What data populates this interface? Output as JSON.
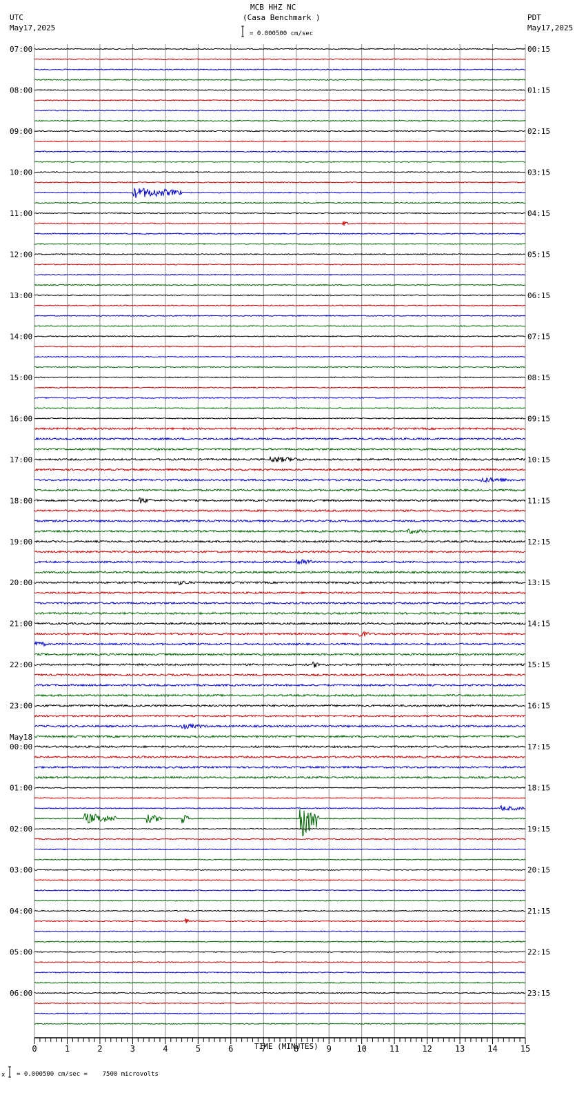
{
  "header": {
    "station": "MCB HHZ NC",
    "location": "(Casa Benchmark )",
    "left_tz": "UTC",
    "left_date": "May17,2025",
    "right_tz": "PDT",
    "right_date": "May17,2025",
    "scale": "= 0.000500 cm/sec"
  },
  "footer": {
    "scale": "= 0.000500 cm/sec =    7500 microvolts",
    "mark": "x"
  },
  "chart_data": {
    "type": "line",
    "title": "MCB HHZ NC (Casa Benchmark )",
    "xlabel": "TIME (MINUTES)",
    "xlim": [
      0,
      15
    ],
    "x_ticks": [
      "0",
      "1",
      "2",
      "3",
      "4",
      "5",
      "6",
      "7",
      "8",
      "9",
      "10",
      "11",
      "12",
      "13",
      "14",
      "15"
    ],
    "trace_colors": [
      "#000000",
      "#cc0000",
      "#0000cc",
      "#006600"
    ],
    "traces_per_hour": 4,
    "date_change_label": "May18",
    "left_labels": [
      "07:00",
      "08:00",
      "09:00",
      "10:00",
      "11:00",
      "12:00",
      "13:00",
      "14:00",
      "15:00",
      "16:00",
      "17:00",
      "18:00",
      "19:00",
      "20:00",
      "21:00",
      "22:00",
      "23:00",
      "00:00",
      "01:00",
      "02:00",
      "03:00",
      "04:00",
      "05:00",
      "06:00"
    ],
    "right_labels": [
      "00:15",
      "01:15",
      "02:15",
      "03:15",
      "04:15",
      "05:15",
      "06:15",
      "07:15",
      "08:15",
      "09:15",
      "10:15",
      "11:15",
      "12:15",
      "13:15",
      "14:15",
      "15:15",
      "16:15",
      "17:15",
      "18:15",
      "19:15",
      "20:15",
      "21:15",
      "22:15",
      "23:15"
    ],
    "events": [
      {
        "trace": 14,
        "minute": 3.0,
        "duration": 1.5,
        "amplitude": 8
      },
      {
        "trace": 17,
        "minute": 9.4,
        "duration": 0.2,
        "amplitude": 4
      },
      {
        "trace": 40,
        "minute": 7.2,
        "duration": 1.0,
        "amplitude": 5
      },
      {
        "trace": 42,
        "minute": 13.6,
        "duration": 1.2,
        "amplitude": 4
      },
      {
        "trace": 44,
        "minute": 3.2,
        "duration": 0.4,
        "amplitude": 5
      },
      {
        "trace": 47,
        "minute": 11.4,
        "duration": 0.6,
        "amplitude": 4
      },
      {
        "trace": 50,
        "minute": 8.0,
        "duration": 0.5,
        "amplitude": 6
      },
      {
        "trace": 52,
        "minute": 4.4,
        "duration": 0.4,
        "amplitude": 4
      },
      {
        "trace": 57,
        "minute": 9.9,
        "duration": 0.3,
        "amplitude": 6
      },
      {
        "trace": 58,
        "minute": 0.0,
        "duration": 0.4,
        "amplitude": 5
      },
      {
        "trace": 60,
        "minute": 8.5,
        "duration": 0.3,
        "amplitude": 5
      },
      {
        "trace": 66,
        "minute": 4.5,
        "duration": 0.8,
        "amplitude": 4
      },
      {
        "trace": 75,
        "minute": 1.5,
        "duration": 1.0,
        "amplitude": 8
      },
      {
        "trace": 75,
        "minute": 3.4,
        "duration": 0.5,
        "amplitude": 7
      },
      {
        "trace": 75,
        "minute": 4.5,
        "duration": 0.2,
        "amplitude": 8
      },
      {
        "trace": 75,
        "minute": 8.1,
        "duration": 0.6,
        "amplitude": 30
      },
      {
        "trace": 74,
        "minute": 14.2,
        "duration": 0.8,
        "amplitude": 4
      },
      {
        "trace": 85,
        "minute": 4.6,
        "duration": 0.1,
        "amplitude": 5
      }
    ]
  }
}
